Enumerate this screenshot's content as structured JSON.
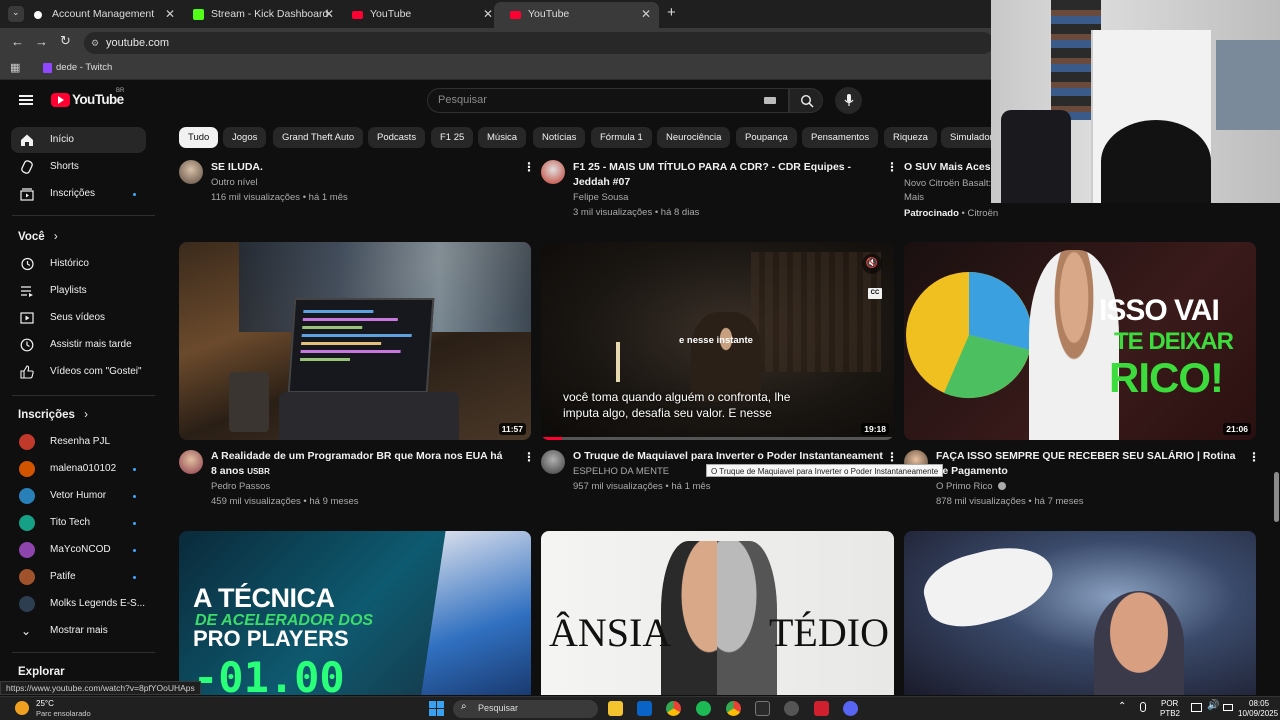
{
  "browser": {
    "tabs": [
      {
        "title": "Account Management",
        "favicon_color": "#ffffff"
      },
      {
        "title": "Stream - Kick Dashboard",
        "favicon_color": "#53fc18"
      },
      {
        "title": "YouTube",
        "favicon_color": "#ff0033"
      },
      {
        "title": "YouTube",
        "favicon_color": "#ff0033"
      }
    ],
    "new_tab_label": "+",
    "url": "youtube.com",
    "bookmark": "dede - Twitch"
  },
  "header": {
    "logo_text": "YouTube",
    "country": "BR",
    "search_placeholder": "Pesquisar"
  },
  "sidebar": {
    "main": [
      {
        "label": "Início"
      },
      {
        "label": "Shorts"
      },
      {
        "label": "Inscrições"
      }
    ],
    "you_heading": "Você",
    "you_items": [
      {
        "label": "Histórico"
      },
      {
        "label": "Playlists"
      },
      {
        "label": "Seus vídeos"
      },
      {
        "label": "Assistir mais tarde"
      },
      {
        "label": "Vídeos com \"Gostei\""
      }
    ],
    "subs_heading": "Inscrições",
    "subs": [
      {
        "label": "Resenha PJL",
        "color": "#c0392b"
      },
      {
        "label": "malena010102",
        "color": "#d35400"
      },
      {
        "label": "Vetor Humor",
        "color": "#2980b9"
      },
      {
        "label": "Tito Tech",
        "color": "#16a085"
      },
      {
        "label": "MaYcoNCOD",
        "color": "#8e44ad"
      },
      {
        "label": "Patife",
        "color": "#a0522d"
      },
      {
        "label": "Molks Legends E-S...",
        "color": "#2c3e50"
      }
    ],
    "show_more": "Mostrar mais",
    "explore_heading": "Explorar"
  },
  "chips": [
    "Tudo",
    "Jogos",
    "Grand Theft Auto",
    "Podcasts",
    "F1 25",
    "Música",
    "Notícias",
    "Fórmula 1",
    "Neurociência",
    "Poupança",
    "Pensamentos",
    "Riqueza",
    "Simulador"
  ],
  "top_row": [
    {
      "title": "SE ILUDA.",
      "channel": "Outro nível",
      "stats": "116 mil visualizações • há 1 mês"
    },
    {
      "title": "F1 25 - MAIS UM TÍTULO PARA A CDR? - CDR Equipes - Jeddah #07",
      "channel": "Felipe Sousa",
      "stats": "3 mil visualizações • há 8 dias"
    },
    {
      "title": "O SUV Mais Acess",
      "channel": "Novo Citroën Basalt:",
      "channel2": "Mais",
      "sponsored": "Patrocinado",
      "sponsor": "• Citroën"
    }
  ],
  "videos": [
    {
      "title": "A Realidade de um Programador BR que Mora nos EUA há 8 anos",
      "title_tag": "USBR",
      "channel": "Pedro Passos",
      "stats": "459 mil visualizações • há 9 meses",
      "duration": "11:57"
    },
    {
      "title": "O Truque de Maquiavel para Inverter o Poder Instantaneamente",
      "channel": "ESPELHO DA MENTE",
      "stats": "957 mil visualizações • há 1 mês",
      "duration": "19:18",
      "caption_small": "e nesse instante",
      "caption_line1": "você toma quando alguém o confronta, lhe",
      "caption_line2": "imputa algo, desafia seu valor. E nesse",
      "cc": "CC"
    },
    {
      "title": "FAÇA ISSO SEMPRE QUE RECEBER SEU SALÁRIO | Rotina de Pagamento",
      "channel": "O Primo Rico",
      "stats": "878 mil visualizações • há 7 meses",
      "duration": "21:06",
      "overlay1": "ISSO VAI",
      "overlay2": "TE DEIXAR",
      "overlay3": "RICO!"
    }
  ],
  "bottom_row": [
    {
      "line1": "A TÉCNICA",
      "line2": "DE ACELERADOR DOS",
      "line3": "PRO PLAYERS",
      "line4": "-01.00"
    },
    {
      "left": "ÂNSIA",
      "right": "TÉDIO"
    },
    {}
  ],
  "tooltip": "O Truque de Maquiavel para Inverter o Poder Instantaneamente",
  "status_url": "https://www.youtube.com/watch?v=8pfYOoUHAps",
  "taskbar": {
    "weather_temp": "25°C",
    "weather_desc": "Parc ensolarado",
    "search": "Pesquisar",
    "lang1": "POR",
    "lang2": "PTB2",
    "time": "08:05",
    "date": "10/09/2025"
  },
  "colors": {
    "accent_red": "#ff0033",
    "chip_bg": "#272727",
    "page_bg": "#0f0f0f"
  }
}
